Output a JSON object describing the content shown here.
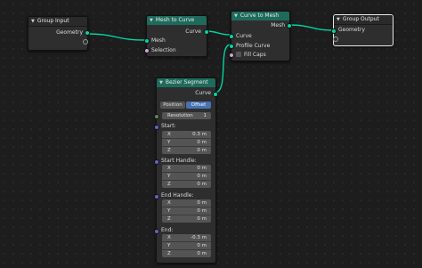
{
  "nodes": {
    "group_input": {
      "title": "Group Input",
      "outputs": [
        "Geometry"
      ]
    },
    "mesh_to_curve": {
      "title": "Mesh to Curve",
      "output": "Curve",
      "inputs": [
        "Mesh",
        "Selection"
      ]
    },
    "curve_to_mesh": {
      "title": "Curve to Mesh",
      "output": "Mesh",
      "inputs": [
        "Curve",
        "Profile Curve"
      ],
      "fill_caps_label": "Fill Caps"
    },
    "group_output": {
      "title": "Group Output",
      "inputs": [
        "Geometry"
      ]
    },
    "bezier_segment": {
      "title": "Bezier Segment",
      "output": "Curve",
      "mode_options": [
        "Position",
        "Offset"
      ],
      "mode_selected": "Offset",
      "resolution_label": "Resolution",
      "resolution_value": "1",
      "start_label": "Start:",
      "start_x": "0.3 m",
      "start_y": "0 m",
      "start_z": "0 m",
      "start_handle_label": "Start Handle:",
      "sh_x": "0 m",
      "sh_y": "0 m",
      "sh_z": "0 m",
      "end_handle_label": "End Handle:",
      "eh_x": "0 m",
      "eh_y": "0 m",
      "eh_z": "0 m",
      "end_label": "End:",
      "end_x": "-0.3 m",
      "end_y": "0 m",
      "end_z": "0 m",
      "axis_x": "X",
      "axis_y": "Y",
      "axis_z": "Z"
    }
  },
  "colors": {
    "geometry_socket": "#00d6a3",
    "wire": "#00d6a3",
    "teal_header": "#1e6b5d",
    "selected_field": "#4772b3"
  }
}
